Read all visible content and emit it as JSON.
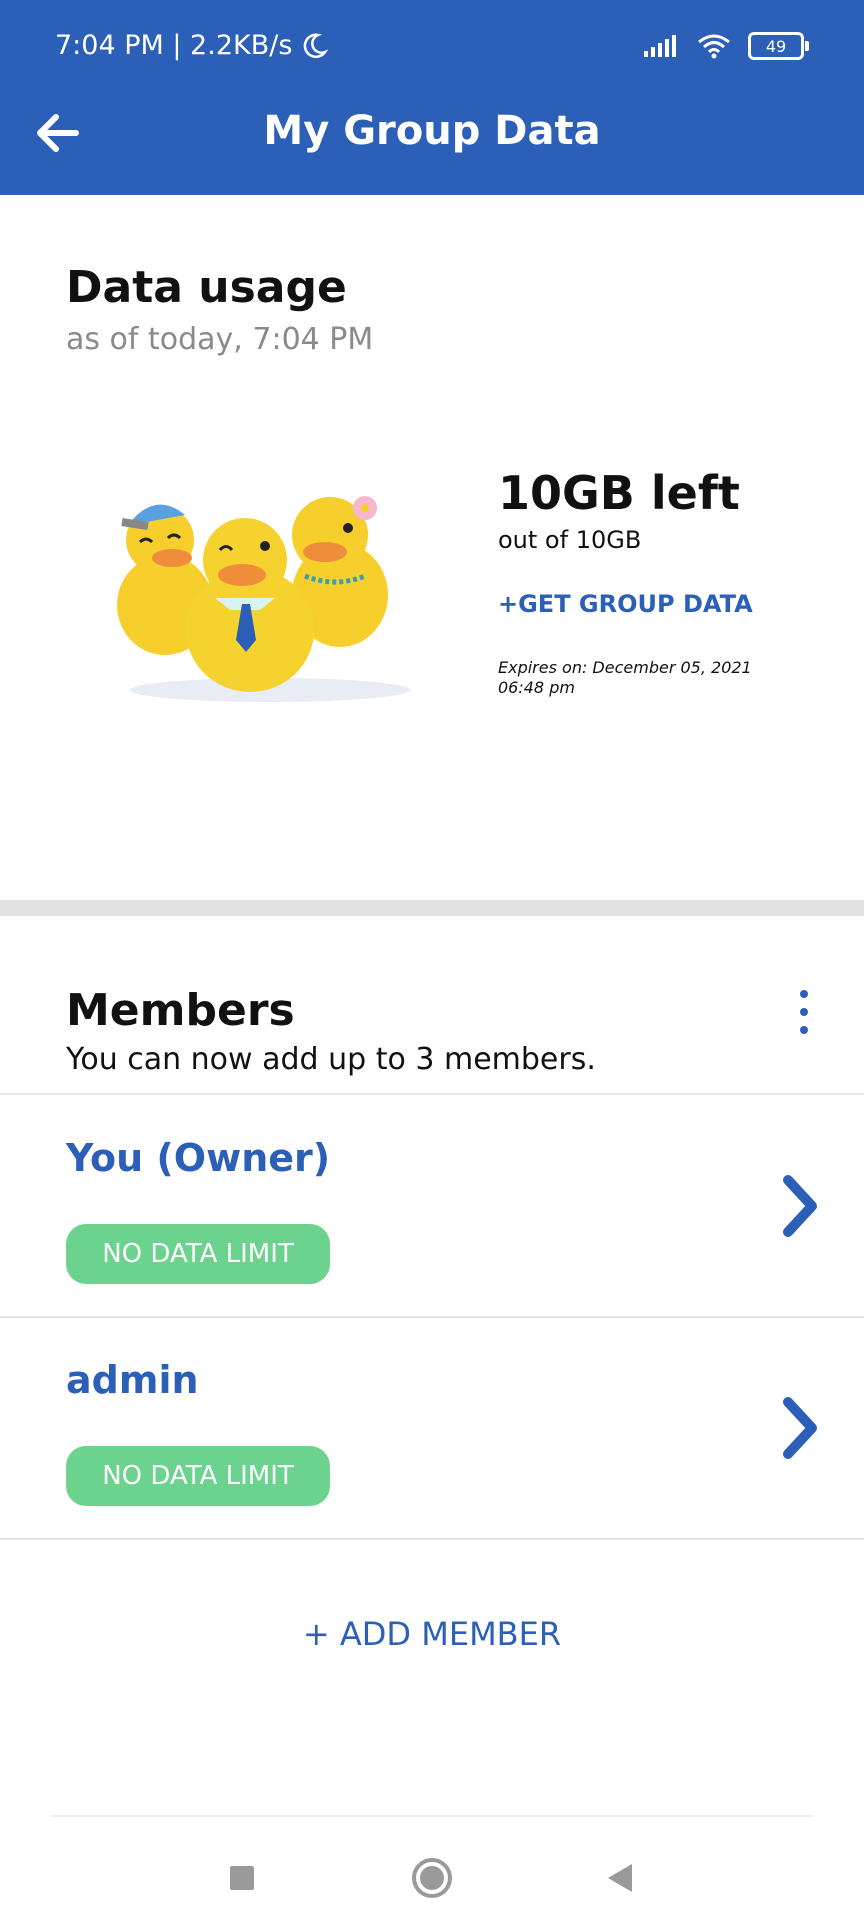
{
  "status_bar": {
    "time": "7:04 PM | 2.2KB/s",
    "battery": "49"
  },
  "header": {
    "title": "My Group Data"
  },
  "data_usage": {
    "title": "Data usage",
    "subtitle": "as of today, 7:04 PM",
    "left": "10GB left",
    "out_of": "out of 10GB",
    "get_group_data": "+GET GROUP DATA",
    "expires": "Expires on: December 05, 2021 06:48 pm"
  },
  "members": {
    "title": "Members",
    "subtitle": "You can now add up to 3 members.",
    "items": [
      {
        "name": "You (Owner)",
        "badge": "NO DATA LIMIT"
      },
      {
        "name": "admin",
        "badge": "NO DATA LIMIT"
      }
    ],
    "add_label": "+ ADD MEMBER"
  },
  "colors": {
    "primary": "#2c5fb8",
    "badge": "#6cd38f",
    "divider": "#e2e2e2"
  },
  "icons": [
    "back-arrow-icon",
    "moon-icon",
    "signal-icon",
    "wifi-icon",
    "battery-icon",
    "kebab-menu-icon",
    "chevron-right-icon",
    "recents-square-icon",
    "home-circle-icon",
    "back-triangle-icon"
  ]
}
